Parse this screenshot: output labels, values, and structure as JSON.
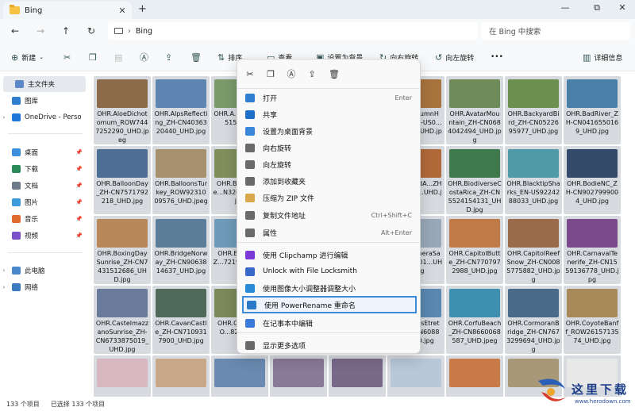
{
  "tab": {
    "title": "Bing",
    "close": "✕",
    "new_tab": "+"
  },
  "window_controls": {
    "minimize": "—",
    "maximize": "⧉",
    "close": "✕"
  },
  "nav": {
    "back": "←",
    "forward": "→",
    "up": "↑",
    "refresh": "↻",
    "more": "›"
  },
  "address": {
    "path": "Bing",
    "search_placeholder": "在 Bing 中搜索"
  },
  "toolbar": {
    "new_label": "新建",
    "sort_label": "排序",
    "view_label": "查看",
    "set_bg_label": "设置为背景",
    "rotate_right_label": "向右旋转",
    "rotate_left_label": "向左旋转",
    "more": "•••",
    "details_label": "详细信息"
  },
  "sidebar": {
    "items": [
      {
        "label": "主文件夹",
        "icon": "home-icon",
        "color": "#5c87c8"
      },
      {
        "label": "图库",
        "icon": "gallery-icon",
        "color": "#2f7fd1"
      },
      {
        "label": "OneDrive - Perso",
        "icon": "cloud-icon",
        "color": "#1f78d8"
      },
      {
        "label": "桌面",
        "icon": "desktop-icon",
        "color": "#3c8ede"
      },
      {
        "label": "下载",
        "icon": "download-icon",
        "color": "#2c8a5a"
      },
      {
        "label": "文档",
        "icon": "document-icon",
        "color": "#6e7a8a"
      },
      {
        "label": "图片",
        "icon": "pictures-icon",
        "color": "#3b9ad9"
      },
      {
        "label": "音乐",
        "icon": "music-icon",
        "color": "#e06b2f"
      },
      {
        "label": "视频",
        "icon": "video-icon",
        "color": "#7b52c9"
      },
      {
        "label": "此电脑",
        "icon": "computer-icon",
        "color": "#4b88c9"
      },
      {
        "label": "网络",
        "icon": "network-icon",
        "color": "#3d7bc0"
      }
    ]
  },
  "files": [
    {
      "name": "OHR.AloeDichotomum_ROW7447252290_UHD.jpeg",
      "color": "#8d6a4a"
    },
    {
      "name": "OHR.AlpsReflecting_ZH-CN4036320440_UHD.jpg",
      "color": "#5f86b3"
    },
    {
      "name": "OHR.A...eProvi...5151_U...",
      "color": "#7a9a6a"
    },
    {
      "name": "",
      "color": "#6a7a58"
    },
    {
      "name": "",
      "color": "#8a6a40"
    },
    {
      "name": "OHR.AutumnHe...ZH-CN-US0...1197_U...UHD.jpg",
      "color": "#a8743e"
    },
    {
      "name": "OHR.AvatarMountain_ZH-CN0684042494_UHD.jpg",
      "color": "#6f8b5a"
    },
    {
      "name": "OHR.BackyardBird_ZH-CN0522695977_UHD.jpg",
      "color": "#6b8f4e"
    },
    {
      "name": "OHR.BadRiver_ZH-CN0416550169_UHD.jpg",
      "color": "#4a7fa8"
    },
    {
      "name": "OHR.BalloonDay_ZH-CN7571792218_UHD.jpg",
      "color": "#4e6f95"
    },
    {
      "name": "OHR.BalloonsTurkey_ROW9231009576_UHD.jpeg",
      "color": "#a6906e"
    },
    {
      "name": "OHR.Ba...Castle...N3201...UHD.jpg",
      "color": "#7e8f5c"
    },
    {
      "name": "",
      "color": "#6b7c8c"
    },
    {
      "name": "",
      "color": "#8b7a5a"
    },
    {
      "name": "OHR.BendA...ZH-CN9954...UHD.jpg",
      "color": "#b06a3a"
    },
    {
      "name": "OHR.BiodiverseCostaRica_ZH-CN5524154131_UHD.jpg",
      "color": "#3f7a4f"
    },
    {
      "name": "OHR.BlacktipSharks_EN-US9224288033_UHD.jpg",
      "color": "#4f9aa8"
    },
    {
      "name": "OHR.BodieNC_ZH-CN9027999004_UHD.jpg",
      "color": "#334a6a"
    },
    {
      "name": "OHR.BoxingDaySunrise_ZH-CN7431512686_UHD.jpg",
      "color": "#b88858"
    },
    {
      "name": "OHR.BridgeNorway_ZH-CN9063814637_UHD.jpg",
      "color": "#5a7d9a"
    },
    {
      "name": "OHR.B...oxes_Z...7219...UHD...",
      "color": "#6e9bb8"
    },
    {
      "name": "",
      "color": "#7a6a5a"
    },
    {
      "name": "",
      "color": "#5a6a7a"
    },
    {
      "name": "OHR.CameraSay...ZH-US01...UHD.jpg",
      "color": "#98a8b8"
    },
    {
      "name": "OHR.CapitolButte_ZH-CN7707972988_UHD.jpg",
      "color": "#c07a48"
    },
    {
      "name": "OHR.CapitolReefSnow_ZH-CN0085775882_UHD.jpg",
      "color": "#9a6a4a"
    },
    {
      "name": "OHR.CarnavalTenerife_ZH-CN1559136778_UHD.jpg",
      "color": "#7a4a8a"
    },
    {
      "name": "OHR.CastelmazzanoSunrise_ZH-CN6733875019_UHD.jpg",
      "color": "#6a7a9a"
    },
    {
      "name": "OHR.CavanCastle_ZH-CN7109317900_UHD.jpg",
      "color": "#4f6a58"
    },
    {
      "name": "OHR.C...ure_RO...82127_...",
      "color": "#7a8a5a"
    },
    {
      "name": "",
      "color": "#8a7a6a"
    },
    {
      "name": "",
      "color": "#6a8aa0"
    },
    {
      "name": "OHR.CliffsEtreta...ZH-CN60884...UHD.jpg",
      "color": "#5a88b0"
    },
    {
      "name": "OHR.CorfuBeach_ZH-CN8660068587_UHD.jpeg",
      "color": "#3f8fb0"
    },
    {
      "name": "OHR.CormoranBridge_ZH-CN7673299694_UHD.jpg",
      "color": "#4a6a8a"
    },
    {
      "name": "OHR.CoyoteBanff_ROW2615713574_UHD.jpg",
      "color": "#a88a5a"
    },
    {
      "name": "",
      "color": "#d8b8c0"
    },
    {
      "name": "",
      "color": "#c8a888"
    },
    {
      "name": "",
      "color": "#6a8ab0"
    },
    {
      "name": "",
      "color": "#8a7a9a"
    },
    {
      "name": "",
      "color": "#7a6a8a"
    },
    {
      "name": "",
      "color": "#b8c8d8"
    },
    {
      "name": "",
      "color": "#c87a48"
    },
    {
      "name": "",
      "color": "#a89878"
    },
    {
      "name": "",
      "color": "#e8e8e8"
    }
  ],
  "context_menu": {
    "top_icons": [
      "cut-icon",
      "copy-icon",
      "rename-icon",
      "share-icon",
      "delete-icon"
    ],
    "top_glyphs": [
      "✂",
      "❐",
      "Ⓐ",
      "⇪",
      "🗑"
    ],
    "items": [
      {
        "label": "打开",
        "shortcut": "Enter",
        "icon": "open-icon",
        "color": "#2f7fd1"
      },
      {
        "label": "共享",
        "shortcut": "",
        "icon": "share-app-icon",
        "color": "#1e6fc8"
      },
      {
        "label": "设置为桌面背景",
        "shortcut": "",
        "icon": "wallpaper-icon",
        "color": "#3a86d8"
      },
      {
        "label": "向右旋转",
        "shortcut": "",
        "icon": "rotate-right-icon",
        "color": "#6a6a6a"
      },
      {
        "label": "向左旋转",
        "shortcut": "",
        "icon": "rotate-left-icon",
        "color": "#6a6a6a"
      },
      {
        "label": "添加到收藏夹",
        "shortcut": "",
        "icon": "star-icon",
        "color": "#6a6a6a"
      },
      {
        "label": "压缩为 ZIP 文件",
        "shortcut": "",
        "icon": "zip-icon",
        "color": "#d8a84a"
      },
      {
        "label": "复制文件地址",
        "shortcut": "Ctrl+Shift+C",
        "icon": "copy-path-icon",
        "color": "#6a6a6a"
      },
      {
        "label": "属性",
        "shortcut": "Alt+Enter",
        "icon": "wrench-icon",
        "color": "#6a6a6a"
      },
      {
        "label": "使用 Clipchamp 进行编辑",
        "shortcut": "",
        "icon": "clipchamp-icon",
        "color": "#7a3ad8"
      },
      {
        "label": "Unlock with File Locksmith",
        "shortcut": "",
        "icon": "lock-icon",
        "color": "#3a6ac8"
      },
      {
        "label": "使用图像大小调整器调整大小",
        "shortcut": "",
        "icon": "resize-icon",
        "color": "#2a8ad8"
      },
      {
        "label": "使用 PowerRename 重命名",
        "shortcut": "",
        "icon": "powerrename-icon",
        "color": "#2a7ac8"
      },
      {
        "label": "在记事本中编辑",
        "shortcut": "",
        "icon": "notepad-icon",
        "color": "#3a7ad8"
      },
      {
        "label": "显示更多选项",
        "shortcut": "",
        "icon": "more-options-icon",
        "color": "#6a6a6a"
      }
    ]
  },
  "status": {
    "count": "133 个项目",
    "selected": "已选择 133 个项目"
  },
  "watermark": {
    "text": "这里下载",
    "url": "www.herodown.com"
  }
}
